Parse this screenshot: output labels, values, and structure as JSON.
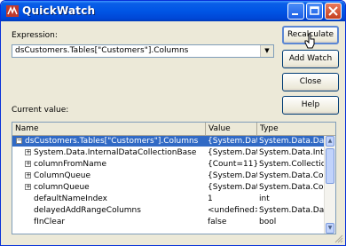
{
  "window": {
    "title": "QuickWatch"
  },
  "expression": {
    "label": "Expression:",
    "value": "dsCustomers.Tables[\"Customers\"].Columns"
  },
  "buttons": {
    "recalculate": "Recalculate",
    "add_watch": "Add Watch",
    "close": "Close",
    "help": "Help"
  },
  "current_value_label": "Current value:",
  "grid": {
    "columns": [
      "Name",
      "Value",
      "Type"
    ],
    "rows": [
      {
        "name": "dsCustomers.Tables[\"Customers\"].Columns",
        "value": "{System.Data",
        "type": "System.Data.Dat",
        "expander": "−",
        "selected": true
      },
      {
        "name": "System.Data.InternalDataCollectionBase",
        "value": "{System.Data",
        "type": "System.Data.Inte",
        "expander": "+"
      },
      {
        "name": "columnFromName",
        "value": "{Count=11}",
        "type": "System.Collection",
        "expander": "+"
      },
      {
        "name": "ColumnQueue",
        "value": "{System.Data",
        "type": "System.Data.Col",
        "expander": "+"
      },
      {
        "name": "columnQueue",
        "value": "{System.Data",
        "type": "System.Data.Col",
        "expander": "+"
      },
      {
        "name": "defaultNameIndex",
        "value": "1",
        "type": "int",
        "expander": ""
      },
      {
        "name": "delayedAddRangeColumns",
        "value": "<undefined>",
        "type": "System.Data.Dat",
        "expander": ""
      },
      {
        "name": "fInClear",
        "value": "false",
        "type": "bool",
        "expander": ""
      }
    ]
  },
  "colors": {
    "titlebar": "#0055e5",
    "selection": "#316ac5",
    "window_bg": "#ece9d8"
  }
}
